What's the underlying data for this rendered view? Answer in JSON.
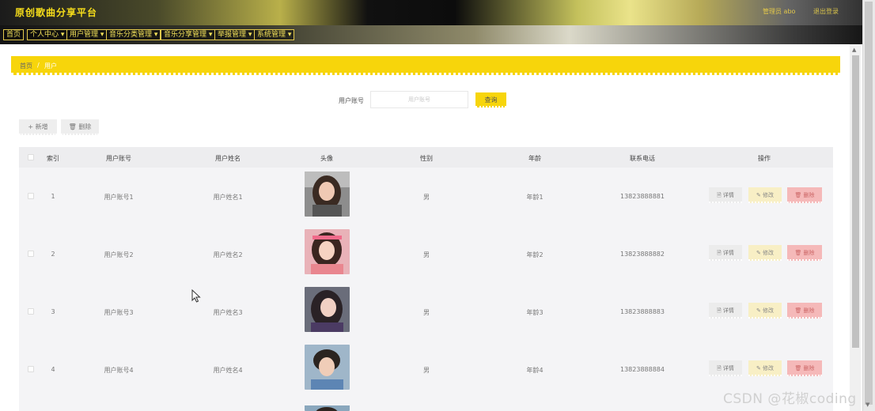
{
  "header": {
    "title": "原创歌曲分享平台",
    "admin": "管理员 abo",
    "logout": "退出登录"
  },
  "nav": [
    {
      "label": "首页"
    },
    {
      "label": "个人中心 ▾"
    },
    {
      "label": "用户管理 ▾"
    },
    {
      "label": "音乐分类管理 ▾"
    },
    {
      "label": "音乐分享管理 ▾"
    },
    {
      "label": "举报管理 ▾"
    },
    {
      "label": "系统管理 ▾"
    }
  ],
  "breadcrumb": {
    "home": "首页",
    "separator": "/",
    "current": "用户"
  },
  "search": {
    "label": "用户账号",
    "placeholder": "用户账号",
    "button": "查询"
  },
  "toolbar": {
    "add": "+ 新增",
    "delete": "🗑 删除"
  },
  "table": {
    "headers": [
      "索引",
      "用户账号",
      "用户姓名",
      "头像",
      "性别",
      "年龄",
      "联系电话",
      "操作"
    ],
    "actions": {
      "detail": "🗎 详情",
      "edit": "✎ 修改",
      "delete": "🗑 删除"
    },
    "rows": [
      {
        "index": "1",
        "account": "用户账号1",
        "name": "用户姓名1",
        "gender": "男",
        "age": "年龄1",
        "phone": "13823888881"
      },
      {
        "index": "2",
        "account": "用户账号2",
        "name": "用户姓名2",
        "gender": "男",
        "age": "年龄2",
        "phone": "13823888882"
      },
      {
        "index": "3",
        "account": "用户账号3",
        "name": "用户姓名3",
        "gender": "男",
        "age": "年龄3",
        "phone": "13823888883"
      },
      {
        "index": "4",
        "account": "用户账号4",
        "name": "用户姓名4",
        "gender": "男",
        "age": "年龄4",
        "phone": "13823888884"
      }
    ]
  },
  "watermark": "CSDN @花椒coding",
  "colors": {
    "accent": "#f7d50b",
    "delete": "#f5b9b9",
    "edit": "#f8efc5"
  }
}
